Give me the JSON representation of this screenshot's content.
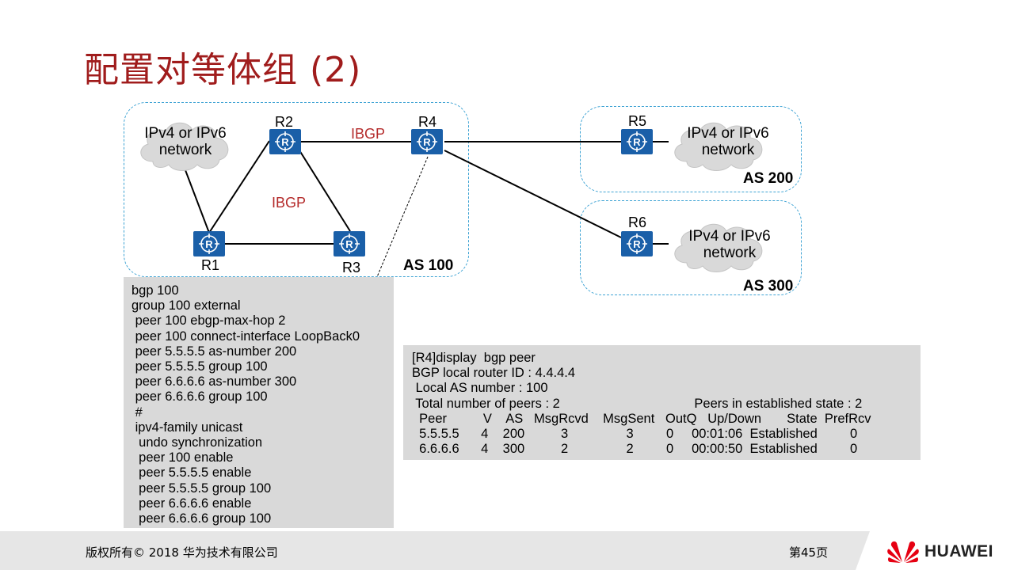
{
  "title": "配置对等体组 (2)",
  "diagram": {
    "routers": {
      "r1": "R1",
      "r2": "R2",
      "r3": "R3",
      "r4": "R4",
      "r5": "R5",
      "r6": "R6"
    },
    "ibgp_label_1": "IBGP",
    "ibgp_label_2": "IBGP",
    "as100": "AS 100",
    "as200": "AS 200",
    "as300": "AS 300",
    "cloud_line1": "IPv4 or IPv6",
    "cloud_line2": "network"
  },
  "config_code": "bgp 100\ngroup 100 external\n peer 100 ebgp-max-hop 2\n peer 100 connect-interface LoopBack0\n peer 5.5.5.5 as-number 200\n peer 5.5.5.5 group 100\n peer 6.6.6.6 as-number 300\n peer 6.6.6.6 group 100\n #\n ipv4-family unicast\n  undo synchronization\n  peer 100 enable\n  peer 5.5.5.5 enable\n  peer 5.5.5.5 group 100\n  peer 6.6.6.6 enable\n  peer 6.6.6.6 group 100",
  "display_code": "[R4]display  bgp peer\nBGP local router ID : 4.4.4.4\n Local AS number : 100\n Total number of peers : 2                                     Peers in established state : 2\n  Peer          V    AS   MsgRcvd    MsgSent   OutQ   Up/Down       State  PrefRcv\n  5.5.5.5      4    200          3                3         0     00:01:06  Established         0\n  6.6.6.6      4    300          2                2         0     00:00:50  Established         0",
  "footer": {
    "copyright": "版权所有© 2018 华为技术有限公司",
    "page": "第45页",
    "brand": "HUAWEI"
  },
  "colors": {
    "title": "#a01c1c",
    "router": "#1a5fa8",
    "as_border": "#3ea3d4",
    "ibgp": "#b42a2a",
    "code_bg": "#d9d9d9"
  }
}
